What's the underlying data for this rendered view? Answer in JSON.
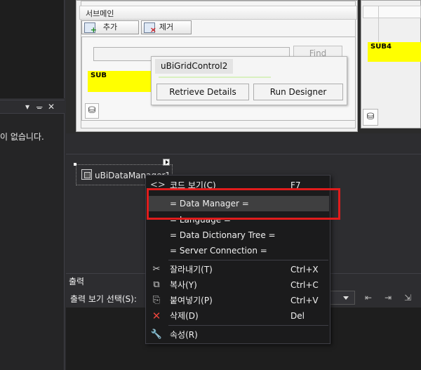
{
  "left_panel": {
    "message": "이 없습니다.",
    "toolbar_icons": [
      "chevron-down-icon",
      "pin-icon",
      "close-icon"
    ]
  },
  "designer": {
    "sub_header": "서브메인",
    "add_button": "추가",
    "remove_button": "제거",
    "find_button": "Find",
    "sub_label": "SUB",
    "sub4_label": "SUB4"
  },
  "smart_tag": {
    "title": "uBiGridControl2",
    "retrieve_button": "Retrieve Details",
    "designer_button": "Run Designer"
  },
  "component": {
    "label": "uBiDataManager1"
  },
  "context_menu": {
    "items": [
      {
        "label": "코드 보기(C)",
        "shortcut": "F7",
        "icon": "code-icon"
      },
      {
        "label": "= Data Manager =",
        "shortcut": "",
        "icon": ""
      },
      {
        "label": "= Language =",
        "shortcut": "",
        "icon": ""
      },
      {
        "label": "= Data Dictionary Tree =",
        "shortcut": "",
        "icon": ""
      },
      {
        "label": "= Server Connection =",
        "shortcut": "",
        "icon": ""
      },
      {
        "label": "잘라내기(T)",
        "shortcut": "Ctrl+X",
        "icon": "cut-icon"
      },
      {
        "label": "복사(Y)",
        "shortcut": "Ctrl+C",
        "icon": "copy-icon"
      },
      {
        "label": "붙여넣기(P)",
        "shortcut": "Ctrl+V",
        "icon": "paste-icon"
      },
      {
        "label": "삭제(D)",
        "shortcut": "Del",
        "icon": "delete-icon"
      },
      {
        "label": "속성(R)",
        "shortcut": "",
        "icon": "properties-icon"
      }
    ],
    "highlighted": "= Data Manager =",
    "highlight_color": "#e01c1c"
  },
  "output_panel": {
    "title": "출력",
    "show_label": "출력 보기 선택(S):"
  }
}
